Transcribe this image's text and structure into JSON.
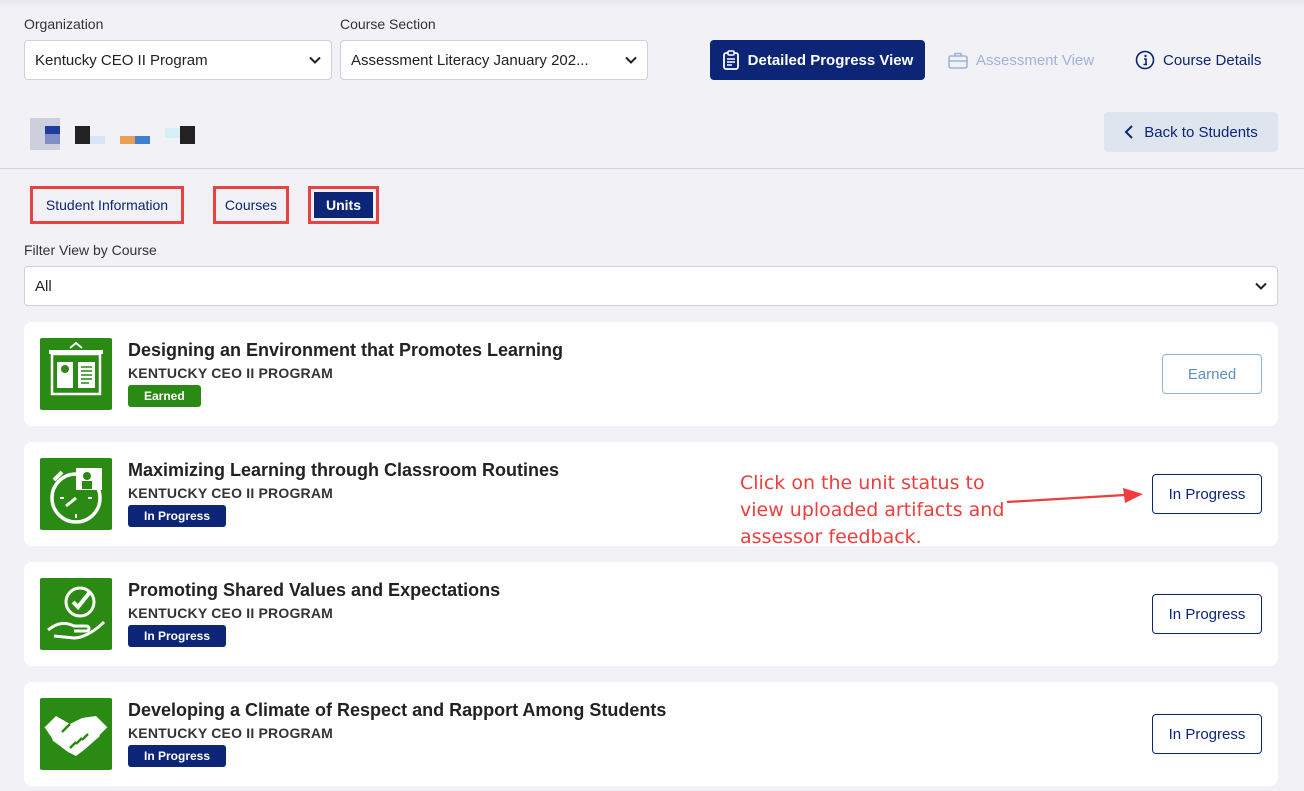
{
  "filters": {
    "organization_label": "Organization",
    "organization_value": "Kentucky CEO II Program",
    "section_label": "Course Section",
    "section_value": "Assessment Literacy January 202..."
  },
  "toolbar": {
    "detailed_progress_label": "Detailed Progress View",
    "assessment_view_label": "Assessment View",
    "course_details_label": "Course Details"
  },
  "back_button_label": "Back to Students",
  "tabs": [
    {
      "label": "Student Information",
      "active": false
    },
    {
      "label": "Courses",
      "active": false
    },
    {
      "label": "Units",
      "active": true
    }
  ],
  "course_filter": {
    "label": "Filter View by Course",
    "value": "All"
  },
  "units": [
    {
      "title": "Designing an Environment that Promotes Learning",
      "org": "KENTUCKY CEO II PROGRAM",
      "badge": "Earned",
      "status": "Earned",
      "icon": "presentation-board-icon"
    },
    {
      "title": "Maximizing Learning through Classroom Routines",
      "org": "KENTUCKY CEO II PROGRAM",
      "badge": "In Progress",
      "status": "In Progress",
      "icon": "clock-teacher-icon"
    },
    {
      "title": "Promoting Shared Values and Expectations",
      "org": "KENTUCKY CEO II PROGRAM",
      "badge": "In Progress",
      "status": "In Progress",
      "icon": "hand-checkmark-icon"
    },
    {
      "title": "Developing a Climate of Respect and Rapport Among Students",
      "org": "KENTUCKY CEO II PROGRAM",
      "badge": "In Progress",
      "status": "In Progress",
      "icon": "handshake-icon"
    }
  ],
  "annotation": {
    "line1": "Click on the unit status to",
    "line2": "view uploaded artifacts and",
    "line3": "assessor feedback."
  },
  "colors": {
    "primary": "#0c2577",
    "success": "#2a8a13",
    "annotation": "#ee3d3d"
  }
}
